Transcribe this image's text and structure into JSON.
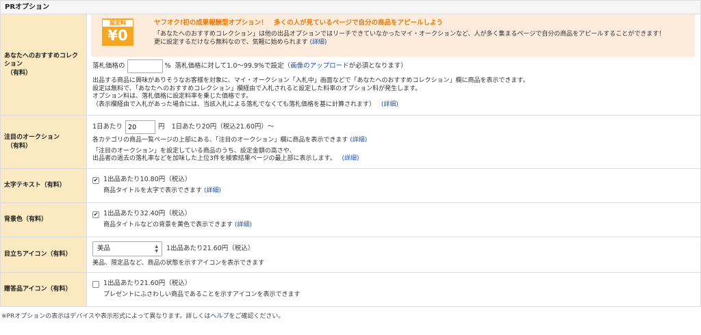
{
  "section_title": "PRオプション",
  "collection": {
    "label_line1": "あなたへのおすすめコレクション",
    "label_line2": "（有料）",
    "badge_label": "設定料",
    "badge_value": "¥0",
    "promo_title": "ヤフオク!初の成果報酬型オプション！　多くの人が見ているページで自分の商品をアピールしよう",
    "promo_line1": "「あなたへのおすすめコレクション」は他の出品オプションではリーチできていなかったマイ・オークションなど、人が多く集まるページで自分の商品をアピールすることができます！",
    "promo_line2": "更に設定するだけなら無料なので、気軽に始められます",
    "promo_link": "(詳細)",
    "rate_label": "落札価格の",
    "rate_value": "",
    "rate_unit": "%",
    "rate_note_pre": "落札価格に対して1.0～99.9%で設定（",
    "rate_note_link": "画像のアップロード",
    "rate_note_post": "が必須となります）",
    "desc1": "出品する商品に興味がありそうなお客様を対象に、マイ・オークション「入札中」画面などで「あなたへのおすすめコレクション」欄に商品を表示できます。",
    "desc2": "設定は無料で、「あなたへのおすすめコレクション」欄経由で入札されると設定した料率のオプション料が発生します。",
    "desc3": "オプション料は、落札価格に設定料率を乗じた価格です。",
    "desc4": "（表示欄経由で入札があった場合には、当該入札による落札でなくても落札価格を基に計算されます）",
    "desc_link": "(詳細)"
  },
  "featured": {
    "label_line1": "注目のオークション",
    "label_line2": "（有料）",
    "per_day_label": "1日あたり",
    "per_day_value": "20",
    "unit": "円",
    "price_note": "1日あたり20円（税込21.60円）～",
    "desc1": "各カテゴリの商品一覧ページの上部にある、「注目のオークション」欄に商品を表示できます",
    "desc1_link": "(詳細)",
    "desc2": "「注目のオークション」を設定している商品のうち、設定金額の高さや、",
    "desc3": "出品者の過去の落札率などを加味した上位3件を検索結果ページの最上部に表示します。",
    "desc3_link": "(詳細)"
  },
  "bold": {
    "label": "太字テキスト（有料）",
    "check_mark": "✔",
    "price": "1出品あたり10.80円（税込）",
    "desc": "商品タイトルを太字で表示できます",
    "link": "(詳細)"
  },
  "bgcolor": {
    "label": "背景色（有料）",
    "check_mark": "✔",
    "price": "1出品あたり32.40円（税込）",
    "desc": "商品タイトルなどの背景を黄色で表示できます",
    "link": "(詳細)"
  },
  "icon": {
    "label": "目立ちアイコン（有料）",
    "selected": "美品",
    "price": "1出品あたり21.60円（税込）",
    "desc": "美品、限定品など、商品の状態を示すアイコンを表示できます"
  },
  "gift": {
    "label": "贈答品アイコン（有料）",
    "price": "1出品あたり21.60円（税込）",
    "desc": "プレゼントにふさわしい商品であることを示すアイコンを表示できます"
  },
  "footer": {
    "pre": "※PRオプションの表示はデバイスや表示形式によって異なります。詳しくは",
    "link": "ヘルプ",
    "post": "をご確認ください。"
  },
  "colors": {
    "label_bg": "#fbe9c2",
    "promo_bg": "#fdebdc",
    "promo_title": "#f07800",
    "badge": "#f5a623",
    "link": "#1a4fa5"
  }
}
